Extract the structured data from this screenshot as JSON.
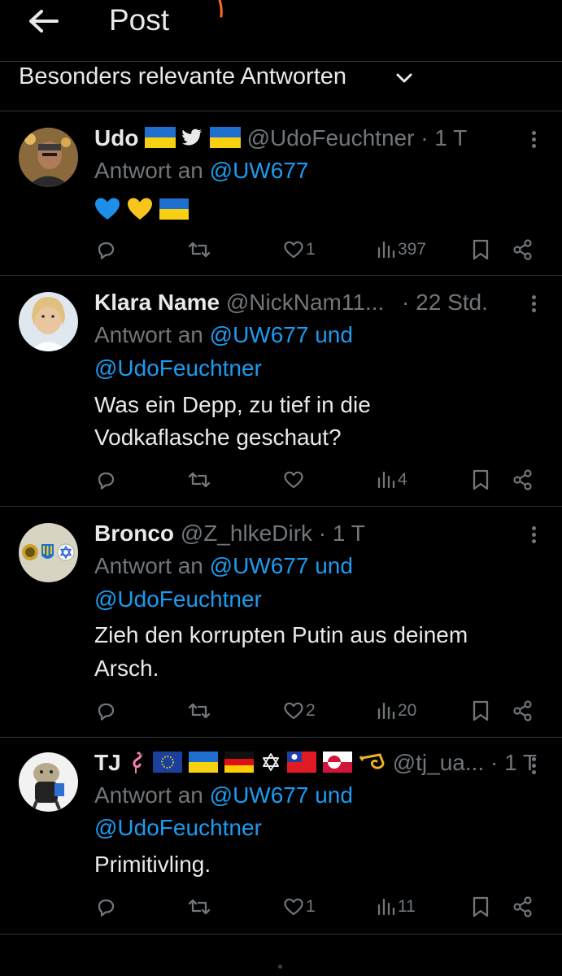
{
  "header": {
    "title": "Post"
  },
  "sort": {
    "label": "Besonders relevante Antworten"
  },
  "reply_prefix": "Antwort an",
  "posts": [
    {
      "name": "Udo",
      "handle": "@UdoFeuchtner",
      "time": "· 1 T",
      "reply_to": "@UW677",
      "reply_to_2": "",
      "text": "",
      "text_2": "",
      "emoji": "blue-heart yellow-heart ukraine-flag",
      "likes": "1",
      "views": "397",
      "name_icons": [
        "ukraine-flag",
        "twitter-bird",
        "ukraine-flag"
      ]
    },
    {
      "name": "Klara Name",
      "handle": "@NickNam11...",
      "time": "· 22 Std.",
      "reply_to": "@UW677 und",
      "reply_to_2": "@UdoFeuchtner",
      "text": "Was ein Depp, zu tief in die",
      "text_2": "Vodkaflasche geschaut?",
      "likes": "",
      "views": "4"
    },
    {
      "name": "Bronco",
      "handle": "@Z_hlkeDirk",
      "time": "· 1 T",
      "reply_to": "@UW677 und",
      "reply_to_2": "@UdoFeuchtner",
      "text": "Zieh den korrupten Putin aus deinem",
      "text_2": "Arsch.",
      "likes": "2",
      "views": "20"
    },
    {
      "name": "TJ",
      "handle": "@tj_ua...",
      "time": "· 1 T",
      "reply_to": "@UW677 und",
      "reply_to_2": "@UdoFeuchtner",
      "text": "Primitivling.",
      "text_2": "",
      "likes": "1",
      "views": "11",
      "name_icons": [
        "flamingo",
        "eu-flag",
        "ukraine-flag",
        "germany-flag",
        "star-of-david",
        "taiwan-flag",
        "greenland-flag",
        "postal-horn"
      ]
    }
  ],
  "colors": {
    "background": "#000000",
    "text": "#e7e9ea",
    "muted": "#71767b",
    "link": "#1d9bf0",
    "divider": "#2f3336"
  }
}
